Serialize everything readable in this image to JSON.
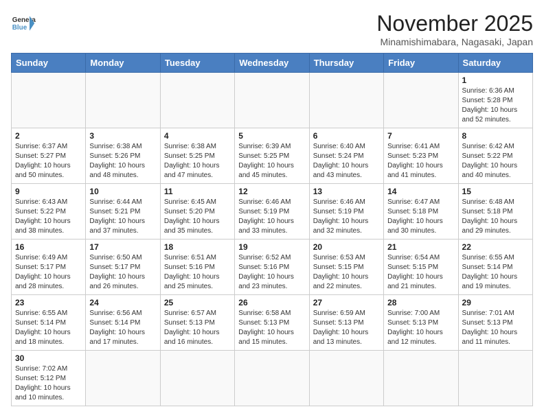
{
  "header": {
    "logo_general": "General",
    "logo_blue": "Blue",
    "month_title": "November 2025",
    "location": "Minamishimabara, Nagasaki, Japan"
  },
  "weekdays": [
    "Sunday",
    "Monday",
    "Tuesday",
    "Wednesday",
    "Thursday",
    "Friday",
    "Saturday"
  ],
  "weeks": [
    [
      {
        "day": "",
        "info": ""
      },
      {
        "day": "",
        "info": ""
      },
      {
        "day": "",
        "info": ""
      },
      {
        "day": "",
        "info": ""
      },
      {
        "day": "",
        "info": ""
      },
      {
        "day": "",
        "info": ""
      },
      {
        "day": "1",
        "info": "Sunrise: 6:36 AM\nSunset: 5:28 PM\nDaylight: 10 hours and 52 minutes."
      }
    ],
    [
      {
        "day": "2",
        "info": "Sunrise: 6:37 AM\nSunset: 5:27 PM\nDaylight: 10 hours and 50 minutes."
      },
      {
        "day": "3",
        "info": "Sunrise: 6:38 AM\nSunset: 5:26 PM\nDaylight: 10 hours and 48 minutes."
      },
      {
        "day": "4",
        "info": "Sunrise: 6:38 AM\nSunset: 5:25 PM\nDaylight: 10 hours and 47 minutes."
      },
      {
        "day": "5",
        "info": "Sunrise: 6:39 AM\nSunset: 5:25 PM\nDaylight: 10 hours and 45 minutes."
      },
      {
        "day": "6",
        "info": "Sunrise: 6:40 AM\nSunset: 5:24 PM\nDaylight: 10 hours and 43 minutes."
      },
      {
        "day": "7",
        "info": "Sunrise: 6:41 AM\nSunset: 5:23 PM\nDaylight: 10 hours and 41 minutes."
      },
      {
        "day": "8",
        "info": "Sunrise: 6:42 AM\nSunset: 5:22 PM\nDaylight: 10 hours and 40 minutes."
      }
    ],
    [
      {
        "day": "9",
        "info": "Sunrise: 6:43 AM\nSunset: 5:22 PM\nDaylight: 10 hours and 38 minutes."
      },
      {
        "day": "10",
        "info": "Sunrise: 6:44 AM\nSunset: 5:21 PM\nDaylight: 10 hours and 37 minutes."
      },
      {
        "day": "11",
        "info": "Sunrise: 6:45 AM\nSunset: 5:20 PM\nDaylight: 10 hours and 35 minutes."
      },
      {
        "day": "12",
        "info": "Sunrise: 6:46 AM\nSunset: 5:19 PM\nDaylight: 10 hours and 33 minutes."
      },
      {
        "day": "13",
        "info": "Sunrise: 6:46 AM\nSunset: 5:19 PM\nDaylight: 10 hours and 32 minutes."
      },
      {
        "day": "14",
        "info": "Sunrise: 6:47 AM\nSunset: 5:18 PM\nDaylight: 10 hours and 30 minutes."
      },
      {
        "day": "15",
        "info": "Sunrise: 6:48 AM\nSunset: 5:18 PM\nDaylight: 10 hours and 29 minutes."
      }
    ],
    [
      {
        "day": "16",
        "info": "Sunrise: 6:49 AM\nSunset: 5:17 PM\nDaylight: 10 hours and 28 minutes."
      },
      {
        "day": "17",
        "info": "Sunrise: 6:50 AM\nSunset: 5:17 PM\nDaylight: 10 hours and 26 minutes."
      },
      {
        "day": "18",
        "info": "Sunrise: 6:51 AM\nSunset: 5:16 PM\nDaylight: 10 hours and 25 minutes."
      },
      {
        "day": "19",
        "info": "Sunrise: 6:52 AM\nSunset: 5:16 PM\nDaylight: 10 hours and 23 minutes."
      },
      {
        "day": "20",
        "info": "Sunrise: 6:53 AM\nSunset: 5:15 PM\nDaylight: 10 hours and 22 minutes."
      },
      {
        "day": "21",
        "info": "Sunrise: 6:54 AM\nSunset: 5:15 PM\nDaylight: 10 hours and 21 minutes."
      },
      {
        "day": "22",
        "info": "Sunrise: 6:55 AM\nSunset: 5:14 PM\nDaylight: 10 hours and 19 minutes."
      }
    ],
    [
      {
        "day": "23",
        "info": "Sunrise: 6:55 AM\nSunset: 5:14 PM\nDaylight: 10 hours and 18 minutes."
      },
      {
        "day": "24",
        "info": "Sunrise: 6:56 AM\nSunset: 5:14 PM\nDaylight: 10 hours and 17 minutes."
      },
      {
        "day": "25",
        "info": "Sunrise: 6:57 AM\nSunset: 5:13 PM\nDaylight: 10 hours and 16 minutes."
      },
      {
        "day": "26",
        "info": "Sunrise: 6:58 AM\nSunset: 5:13 PM\nDaylight: 10 hours and 15 minutes."
      },
      {
        "day": "27",
        "info": "Sunrise: 6:59 AM\nSunset: 5:13 PM\nDaylight: 10 hours and 13 minutes."
      },
      {
        "day": "28",
        "info": "Sunrise: 7:00 AM\nSunset: 5:13 PM\nDaylight: 10 hours and 12 minutes."
      },
      {
        "day": "29",
        "info": "Sunrise: 7:01 AM\nSunset: 5:13 PM\nDaylight: 10 hours and 11 minutes."
      }
    ],
    [
      {
        "day": "30",
        "info": "Sunrise: 7:02 AM\nSunset: 5:12 PM\nDaylight: 10 hours and 10 minutes."
      },
      {
        "day": "",
        "info": ""
      },
      {
        "day": "",
        "info": ""
      },
      {
        "day": "",
        "info": ""
      },
      {
        "day": "",
        "info": ""
      },
      {
        "day": "",
        "info": ""
      },
      {
        "day": "",
        "info": ""
      }
    ]
  ]
}
